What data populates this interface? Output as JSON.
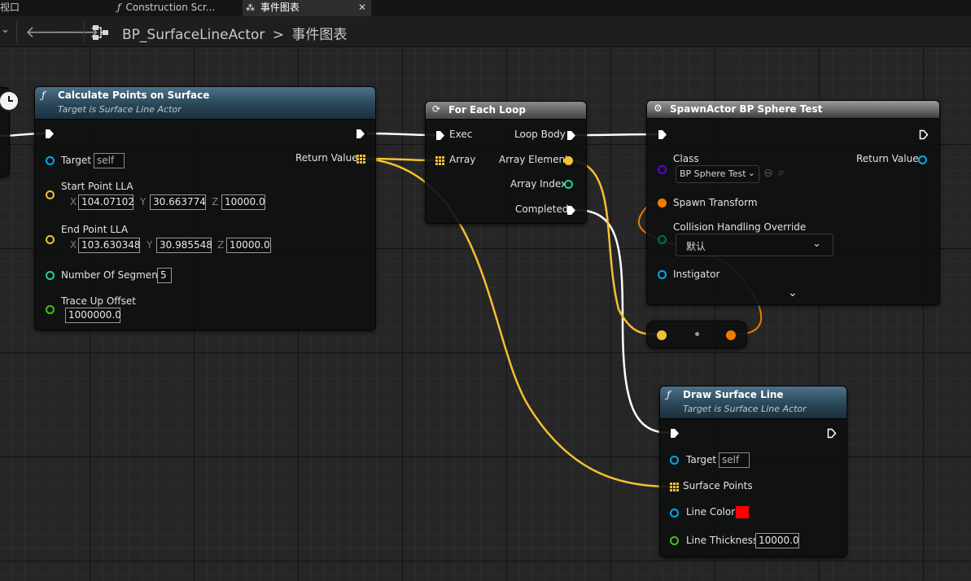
{
  "tabs": [
    {
      "label": "视口"
    },
    {
      "label": "Construction Scr...",
      "icon": "function-icon"
    },
    {
      "label": "事件图表",
      "icon": "event-graph-icon",
      "active": true
    }
  ],
  "breadcrumb": {
    "blueprint": "BP_SurfaceLineActor",
    "separator": ">",
    "graph": "事件图表"
  },
  "nodes": {
    "calculate": {
      "title": "Calculate Points on Surface",
      "subtitle": "Target is Surface Line Actor",
      "target_label": "Target",
      "target_value": "self",
      "start_label": "Start Point LLA",
      "start_x": "104.07102",
      "start_y": "30.663774",
      "start_z": "10000.0",
      "end_label": "End Point LLA",
      "end_x": "103.630348",
      "end_y": "30.985548",
      "end_z": "10000.0",
      "segments_label": "Number Of Segments",
      "segments_value": "5",
      "trace_label": "Trace Up Offset",
      "trace_value": "1000000.0",
      "return_label": "Return Value",
      "axis_x": "X",
      "axis_y": "Y",
      "axis_z": "Z"
    },
    "foreach": {
      "title": "For Each Loop",
      "exec_label": "Exec",
      "array_label": "Array",
      "loop_body_label": "Loop Body",
      "array_element_label": "Array Element",
      "array_index_label": "Array Index",
      "completed_label": "Completed"
    },
    "spawn": {
      "title": "SpawnActor BP Sphere Test",
      "class_label": "Class",
      "class_value": "BP Sphere Test",
      "return_label": "Return Value",
      "spawn_transform_label": "Spawn Transform",
      "collision_label": "Collision Handling Override",
      "collision_value": "默认",
      "instigator_label": "Instigator"
    },
    "draw": {
      "title": "Draw Surface Line",
      "subtitle": "Target is Surface Line Actor",
      "target_label": "Target",
      "target_value": "self",
      "points_label": "Surface Points",
      "color_label": "Line Color",
      "line_color": "#ff0000",
      "thickness_label": "Line Thickness",
      "thickness_value": "10000.0"
    }
  },
  "colors": {
    "exec": "#ffffff",
    "vector": "#f4c131",
    "object": "#00a8f2",
    "int": "#1ecfa0",
    "float": "#39c419",
    "transform": "#f07d00",
    "class": "#5c00d6",
    "byte": "#006d60"
  }
}
